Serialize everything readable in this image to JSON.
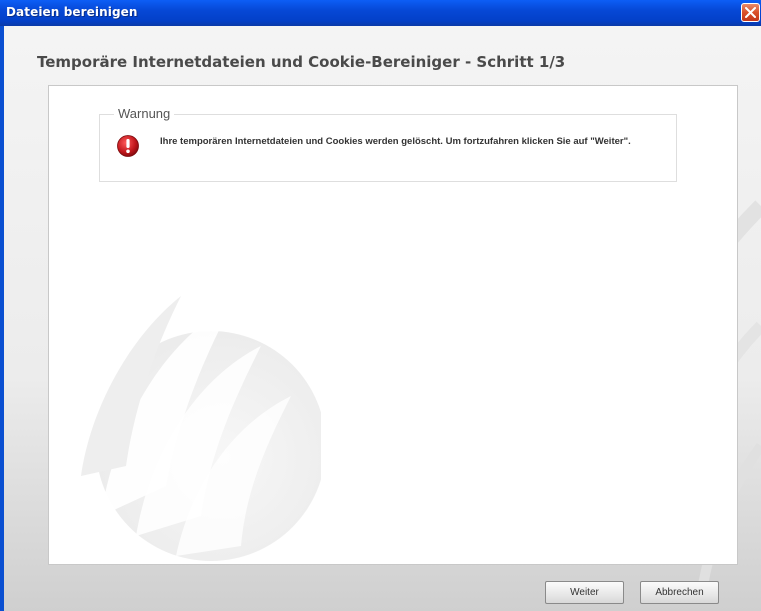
{
  "window": {
    "title": "Dateien bereinigen"
  },
  "heading": "Temporäre Internetdateien und Cookie-Bereiniger - Schritt 1/3",
  "warning": {
    "legend": "Warnung",
    "message": "Ihre temporären Internetdateien und Cookies werden gelöscht. Um fortzufahren klicken Sie auf \"Weiter\".",
    "icon": "error-exclamation-icon"
  },
  "buttons": {
    "next_label": "Weiter",
    "cancel_label": "Abbrechen"
  },
  "colors": {
    "titlebar": "#0a4fd1",
    "close_button": "#d9502a",
    "warning_icon": "#c0161b",
    "heading_text": "#4a4a4a"
  }
}
